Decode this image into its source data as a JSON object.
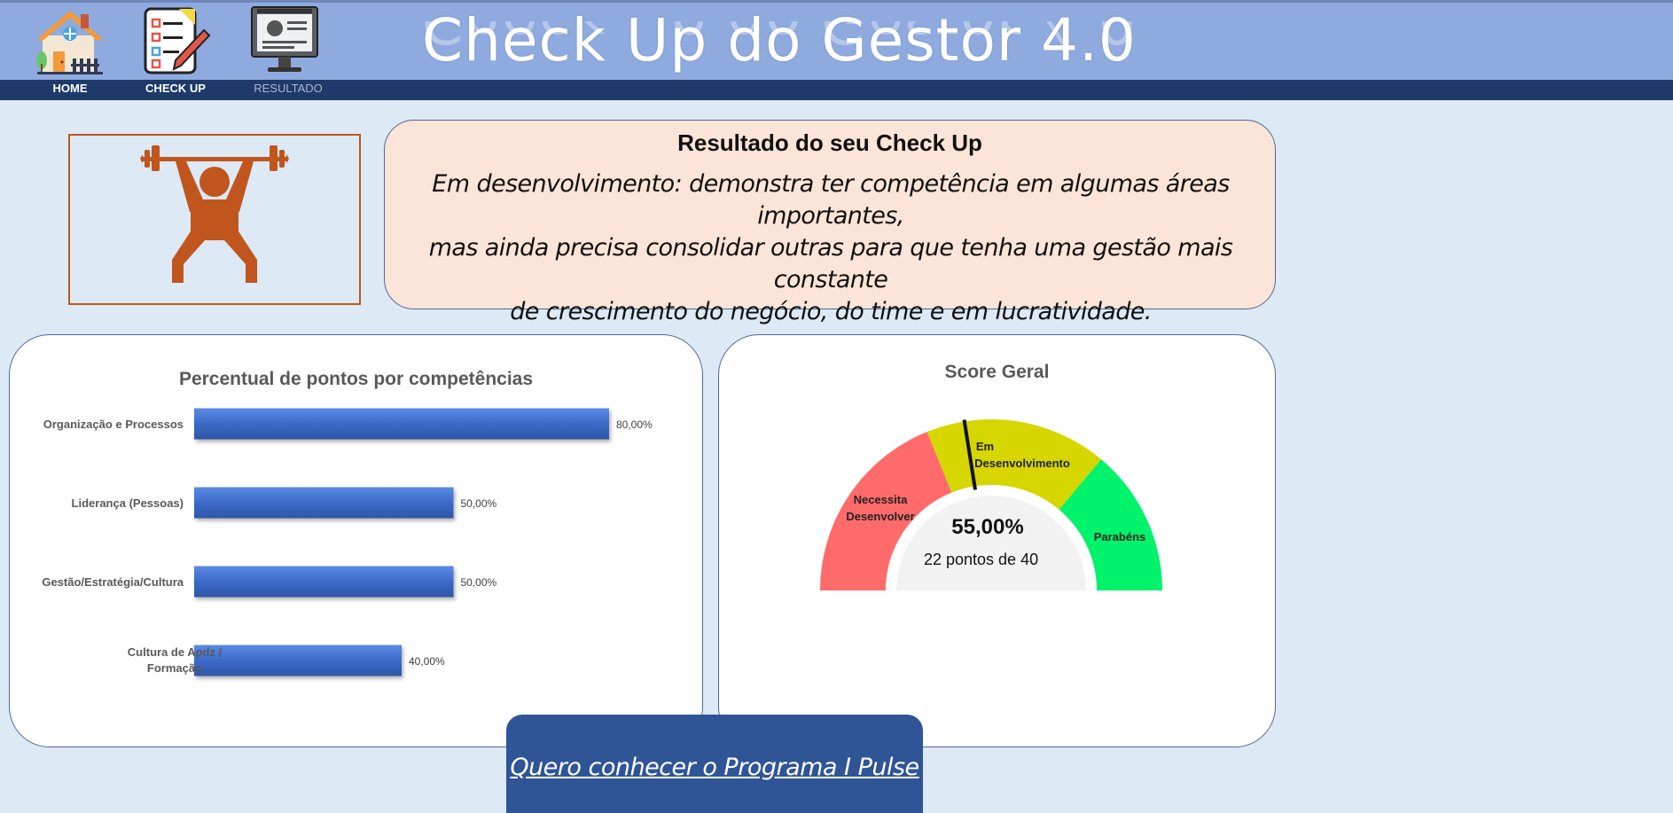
{
  "header": {
    "title": "Check Up do Gestor 4.0",
    "nav": [
      {
        "label": "HOME",
        "icon": "house-icon"
      },
      {
        "label": "CHECK UP",
        "icon": "checklist-icon"
      },
      {
        "label": "RESULTADO",
        "icon": "monitor-icon"
      }
    ]
  },
  "result": {
    "icon": "weightlifter-icon",
    "title": "Resultado do seu Check Up",
    "lines": [
      "Em desenvolvimento: demonstra ter competência em algumas áreas importantes,",
      "mas ainda precisa consolidar outras para que tenha uma gestão mais constante",
      "de crescimento do negócio, do time e em lucratividade."
    ]
  },
  "chart_data": [
    {
      "type": "bar",
      "orientation": "horizontal",
      "title": "Percentual de pontos por competências",
      "categories": [
        "Organização e Processos",
        "Liderança (Pessoas)",
        "Gestão/Estratégia/Cultura",
        "Cultura de Apdz / Formação"
      ],
      "values": [
        80,
        50,
        50,
        40
      ],
      "data_labels": [
        "80,00%",
        "50,00%",
        "50,00%",
        "40,00%"
      ],
      "xlim": [
        0,
        100
      ],
      "grid": false,
      "color": "#3c6ac8"
    },
    {
      "type": "gauge",
      "title": "Score Geral",
      "value_label": "55,00%",
      "value": 55,
      "points": "22",
      "points_suffix": "pontos de 40",
      "bands": [
        {
          "label": "Necessita Desenvolver",
          "color": "#ff6b6b"
        },
        {
          "label": "Em Desenvolvimento",
          "color": "#d6d600"
        },
        {
          "label": "Parabéns",
          "color": "#00f36b"
        }
      ]
    }
  ],
  "cta": {
    "label": "Quero conhecer o Programa I Pulse"
  }
}
